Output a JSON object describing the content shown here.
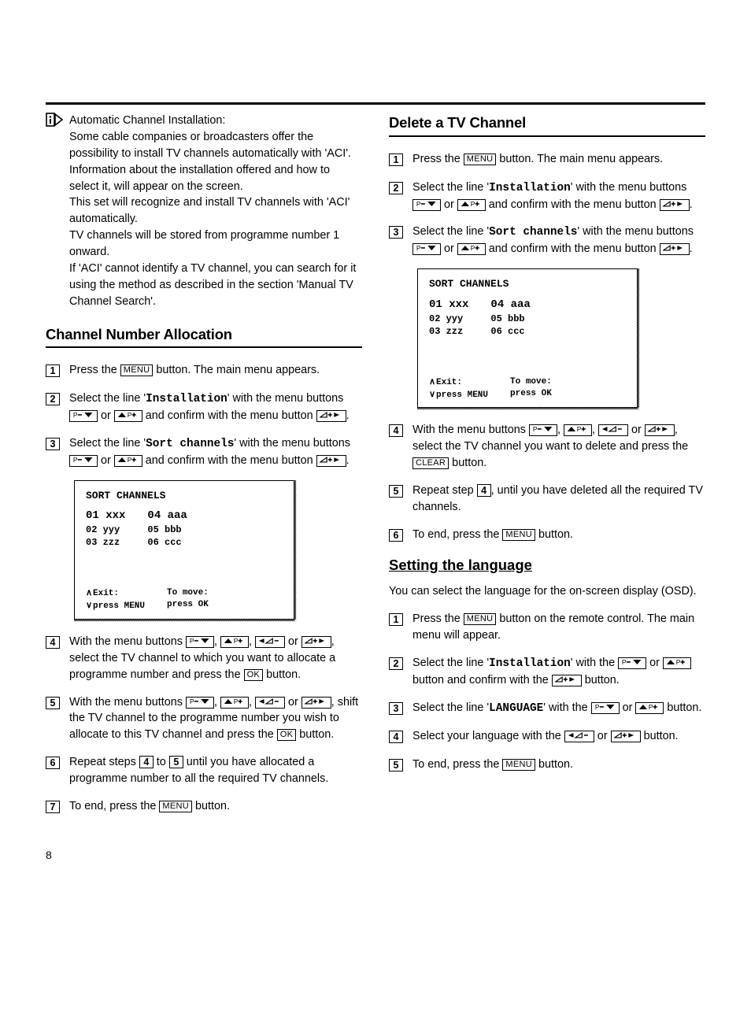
{
  "page_number": "8",
  "buttons": {
    "menu": "MENU",
    "ok": "OK",
    "clear": "CLEAR"
  },
  "note": {
    "title": "Automatic Channel Installation:",
    "p1": "Some cable companies or broadcasters offer the possibility to install TV channels automatically with 'ACI'. Information about the installation offered and how to select it, will appear on the screen.",
    "p2": "This set will recognize and install TV channels with 'ACI' automatically.",
    "p3": "TV channels will be stored from programme number 1 onward.",
    "p4": "If 'ACI' cannot identify a TV channel, you can search for it using the method as described in the section 'Manual TV Channel Search'."
  },
  "cna": {
    "heading": "Channel Number Allocation",
    "step1a": "Press the ",
    "step1b": " button. The main menu appears.",
    "step2a": "Select the line '",
    "step2_code": "Installation",
    "step2b": "' with the menu buttons ",
    "step2_or": " or ",
    "step2c": " and confirm with the menu button ",
    "step2d": ".",
    "step3a": "Select the line '",
    "step3_code": "Sort channels",
    "step3b": "' with the menu buttons ",
    "step3_or": " or ",
    "step3c": " and confirm with the menu button ",
    "step3d": ".",
    "step4a": "With the menu buttons ",
    "step4_or": " or ",
    "step4b": ", select the TV channel to which you want to allocate a programme number and press the ",
    "step4c": " button.",
    "step5a": "With the menu buttons ",
    "step5b": ", shift the TV channel to the programme number you wish to allocate to this TV channel and press the ",
    "step5c": " button.",
    "step6a": "Repeat steps ",
    "step6_to": " to ",
    "step6b": " until you have allocated a programme number to all the required TV channels.",
    "step7a": "To end, press the ",
    "step7b": " button.",
    "ref4": "4",
    "ref5": "5"
  },
  "del": {
    "heading": "Delete a TV Channel",
    "step1a": "Press the ",
    "step1b": " button. The main menu appears.",
    "step2a": "Select the line '",
    "step2_code": "Installation",
    "step2b": "' with the menu buttons ",
    "step2_or": " or ",
    "step2c": " and confirm with the menu button ",
    "step2d": ".",
    "step3a": "Select the line '",
    "step3_code": "Sort channels",
    "step3b": "' with the menu buttons ",
    "step3_or": " or ",
    "step3c": " and confirm with the menu button ",
    "step3d": ".",
    "step4a": "With the menu buttons ",
    "step4_or": " or ",
    "step4b": ", select the TV channel you want to delete and press the ",
    "step4c": " button.",
    "step5a": "Repeat step ",
    "step5b": ", until you have deleted all the required TV channels.",
    "step6a": "To end, press the ",
    "step6b": " button.",
    "ref4": "4"
  },
  "lang": {
    "heading": "Setting the language",
    "intro": "You can select the language for the on-screen display (OSD).",
    "step1a": "Press the ",
    "step1b": " button on the remote control. The main menu will appear.",
    "step2a": "Select the line '",
    "step2_code": "Installation",
    "step2b": "' with the ",
    "step2_or": " or ",
    "step2c": " button and confirm with the ",
    "step2d": " button.",
    "step3a": "Select the line '",
    "step3_code": "LANGUAGE",
    "step3b": "' with the ",
    "step3_or": " or ",
    "step3c": " button.",
    "step4a": "Select your language with the ",
    "step4_or": " or ",
    "step4b": " button.",
    "step5a": "To end, press the ",
    "step5b": " button."
  },
  "osd": {
    "title": "SORT CHANNELS",
    "colA": [
      "01 xxx",
      "02 yyy",
      "03 zzz"
    ],
    "colB": [
      "04 aaa",
      "05 bbb",
      "06 ccc"
    ],
    "exit1": "Exit:",
    "exit2": "press MENU",
    "move1": "To move:",
    "move2": "press OK"
  },
  "stepnums": {
    "n1": "1",
    "n2": "2",
    "n3": "3",
    "n4": "4",
    "n5": "5",
    "n6": "6",
    "n7": "7"
  },
  "sep_comma": ", "
}
